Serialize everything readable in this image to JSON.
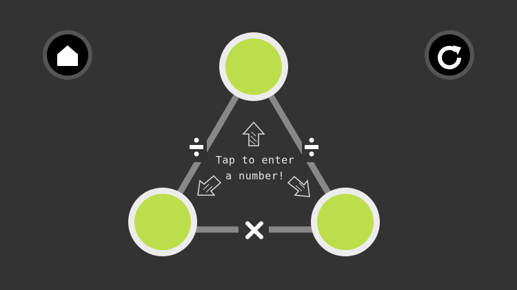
{
  "screen": {
    "background_color": "#333333"
  },
  "toolbar": {
    "home_icon": "home-icon",
    "restart_icon": "restart-icon"
  },
  "puzzle": {
    "node_fill_color": "#bedd4b",
    "node_ring_color": "#ececec",
    "edge_color": "#888888",
    "nodes": [
      "top",
      "bottom-left",
      "bottom-right"
    ],
    "operators": {
      "left_edge": "÷",
      "right_edge": "÷",
      "bottom_edge": "×"
    },
    "hint_line_1": "Tap to enter",
    "hint_line_2": "a number!",
    "hint_arrows": [
      "arrow-up-icon",
      "arrow-down-left-icon",
      "arrow-down-right-icon"
    ]
  }
}
